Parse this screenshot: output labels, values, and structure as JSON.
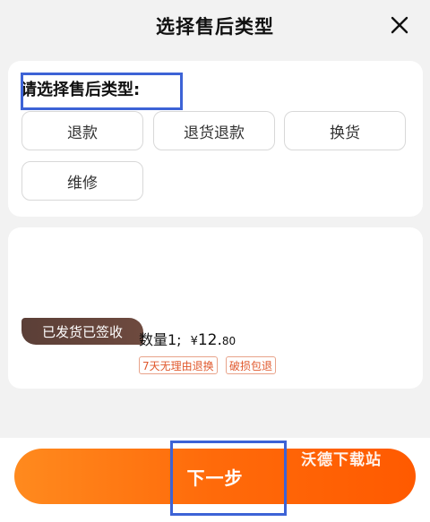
{
  "header": {
    "title": "选择售后类型",
    "close_icon": "close-icon"
  },
  "type_section": {
    "label": "请选择售后类型:",
    "options": [
      {
        "label": "退款"
      },
      {
        "label": "退货退款"
      },
      {
        "label": "换货"
      },
      {
        "label": "维修"
      }
    ]
  },
  "product": {
    "status_badge": "已发货已签收",
    "quantity": "数量1;",
    "price_symbol": "¥",
    "price_integer": "12.",
    "price_decimal": "80",
    "tags": [
      "7天无理由退换",
      "破损包退"
    ]
  },
  "footer": {
    "next_label": "下一步",
    "watermark": "沃德下载站"
  },
  "colors": {
    "accent": "#ff6a0a",
    "highlight": "#3d63d6",
    "badge": "#5b3f37",
    "tag": "#e0582c"
  }
}
